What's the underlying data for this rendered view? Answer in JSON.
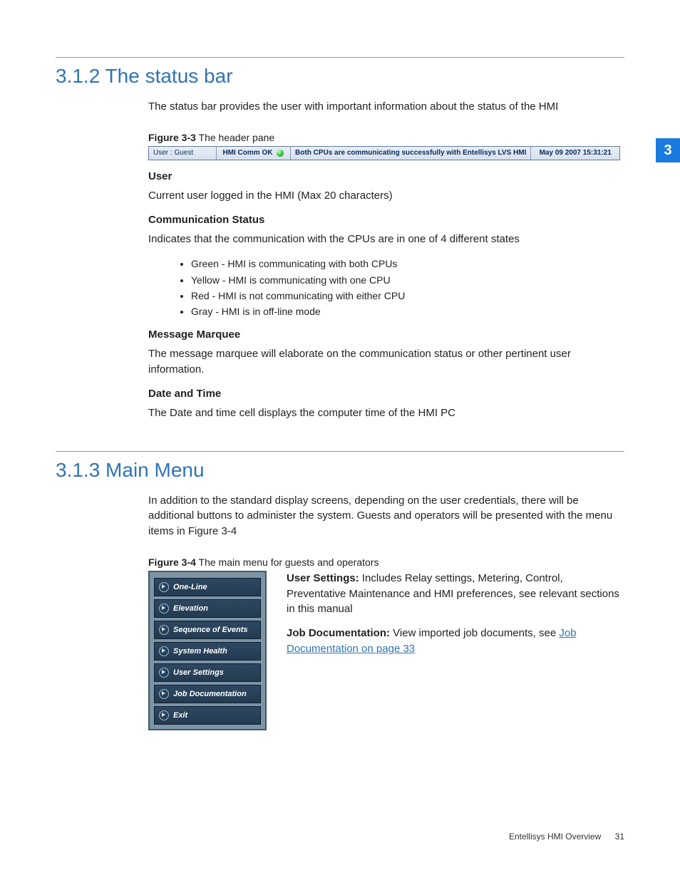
{
  "chapter_tab": "3",
  "section_312": {
    "heading": "3.1.2 The status bar",
    "intro": "The status bar provides the user with important information about the status of the HMI",
    "fig_caption_label": "Figure 3-3",
    "fig_caption_text": "  The header pane",
    "statusbar": {
      "user": "User : Guest",
      "comm": "HMI Comm OK",
      "message": "Both CPUs are communicating successfully with Entellisys LVS HMI",
      "datetime": "May 09 2007  15:31:21"
    },
    "user_head": "User",
    "user_desc": "Current user logged in the HMI (Max 20 characters)",
    "comm_head": "Communication Status",
    "comm_desc": "Indicates that the communication with the CPUs are in one of 4 different states",
    "states": [
      "Green - HMI is communicating with both CPUs",
      "Yellow - HMI is communicating with one CPU",
      "Red - HMI is not communicating with either CPU",
      "Gray - HMI is in off-line mode"
    ],
    "marquee_head": "Message Marquee",
    "marquee_desc": "The message marquee will elaborate on the communication status or other pertinent user information.",
    "dt_head": "Date and Time",
    "dt_desc": "The Date and time cell displays the computer time of the HMI PC"
  },
  "section_313": {
    "heading": "3.1.3 Main Menu",
    "intro": "In addition to the standard display screens, depending on the user credentials, there will be additional buttons to administer the system. Guests and operators will be presented with the menu items in Figure 3-4",
    "fig_caption_label": "Figure 3-4",
    "fig_caption_text": "  The main menu for guests and operators",
    "menu_items": [
      "One-Line",
      "Elevation",
      "Sequence of Events",
      "System Health",
      "User Settings",
      "Job Documentation",
      "Exit"
    ],
    "user_settings_label": "User Settings:",
    "user_settings_text": " Includes Relay settings, Metering, Control, Preventative Maintenance and HMI preferences, see relevant sections in this manual",
    "job_doc_label": "Job Documentation:",
    "job_doc_text_pre": " View imported job documents, see ",
    "job_doc_link": "Job Documentation on page 33"
  },
  "footer": {
    "title": "Entellisys HMI Overview",
    "page": "31"
  }
}
